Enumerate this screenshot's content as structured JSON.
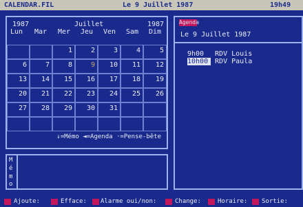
{
  "titlebar": {
    "filename": "CALENDAR.FIL",
    "date": "Le 9 Juillet 1987",
    "time": "19h49"
  },
  "calendar": {
    "year_left": "1987",
    "month": "Juillet",
    "year_right": "1987",
    "weekdays": [
      "Lun",
      "Mar",
      "Mer",
      "Jeu",
      "Ven",
      "Sam",
      "Dim"
    ],
    "weeks": [
      [
        "",
        "",
        "1",
        "2",
        "3",
        "4",
        "5"
      ],
      [
        "6",
        "7",
        "8",
        "9",
        "10",
        "11",
        "12"
      ],
      [
        "13",
        "14",
        "15",
        "16",
        "17",
        "18",
        "19"
      ],
      [
        "20",
        "21",
        "22",
        "23",
        "24",
        "25",
        "26"
      ],
      [
        "27",
        "28",
        "29",
        "30",
        "31",
        "",
        ""
      ],
      [
        "",
        "",
        "",
        "",
        "",
        "",
        ""
      ]
    ],
    "highlighted_day": "9",
    "legend": "↓=Mémo ◄=Agenda ·=Pense-bête"
  },
  "agenda": {
    "tab_label": "Agenda",
    "date": "Le 9 Juillet 1987",
    "appointments": [
      {
        "time": "9h00",
        "text": "RDV Louis"
      },
      {
        "time": "10h00",
        "text": "RDV Paula"
      }
    ]
  },
  "memo": {
    "side_letters": [
      "M",
      "é",
      "m",
      "o"
    ]
  },
  "footer": {
    "items": [
      "Ajoute:",
      "Efface:",
      "Alarme oui/non:",
      "Change:",
      "Horaire:",
      "Sortie:"
    ]
  },
  "colors": {
    "background": "#1a2a8c",
    "accent": "#c2185b",
    "border": "#9fb2ec"
  }
}
